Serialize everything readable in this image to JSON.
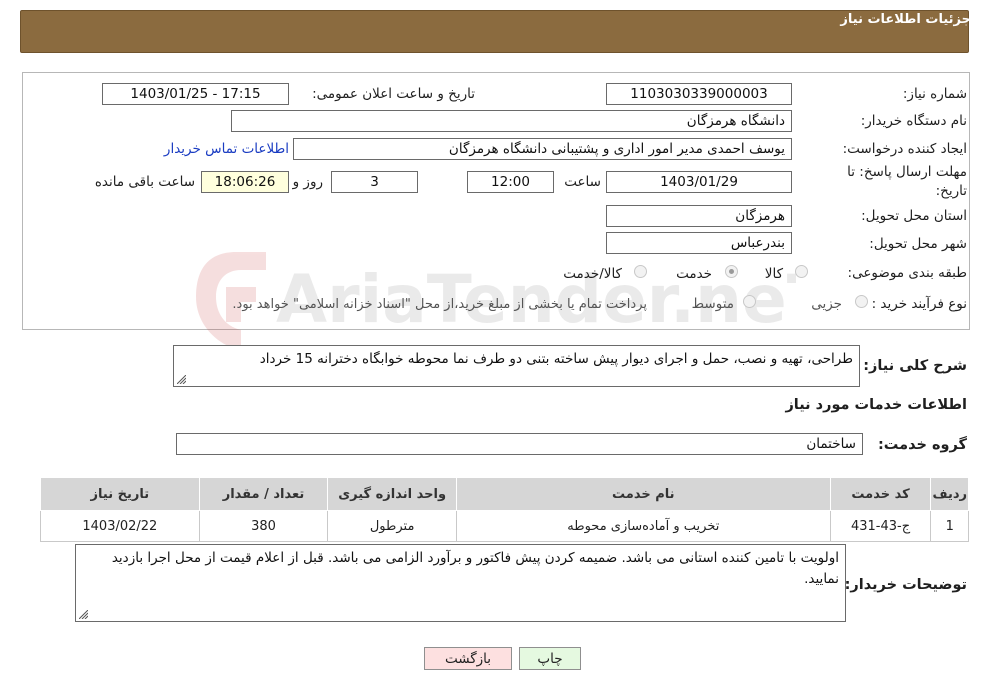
{
  "header": {
    "title": "جزئیات اطلاعات نیاز"
  },
  "form": {
    "need_number_label": "شماره نیاز:",
    "need_number_value": "1103030339000003",
    "announce_label": "تاریخ و ساعت اعلان عمومی:",
    "announce_value": "1403/01/25 - 17:15",
    "buyer_org_label": "نام دستگاه خریدار:",
    "buyer_org_value": "دانشگاه هرمزگان",
    "requester_label": "ایجاد کننده درخواست:",
    "requester_value": "یوسف احمدی مدیر امور اداری و پشتیبانی دانشگاه هرمزگان",
    "contact_link": "اطلاعات تماس خریدار",
    "deadline_label_line1": "مهلت ارسال پاسخ: تا",
    "deadline_label_line2": "تاریخ:",
    "deadline_date": "1403/01/29",
    "time_label": "ساعت",
    "deadline_time": "12:00",
    "days_value": "3",
    "days_label": "روز و",
    "remaining_value": "18:06:26",
    "remaining_label": "ساعت باقی مانده",
    "province_label": "استان محل تحویل:",
    "province_value": "هرمزگان",
    "city_label": "شهر محل تحویل:",
    "city_value": "بندرعباس",
    "category_label": "طبقه بندی موضوعی:",
    "category_options": [
      "کالا",
      "خدمت",
      "کالا/خدمت"
    ],
    "category_selected": "خدمت",
    "process_label": "نوع فرآیند خرید :",
    "process_options": [
      "جزیی",
      "متوسط"
    ],
    "payment_note": "پرداخت تمام یا بخشی از مبلغ خرید،از محل \"اسناد خزانه اسلامی\" خواهد بود."
  },
  "description": {
    "label": "شرح کلی نیاز:",
    "value": "طراحی، تهیه و نصب، حمل و اجرای دیوار پیش ساخته بتنی دو طرف نما محوطه خوابگاه دخترانه 15 خرداد"
  },
  "services": {
    "section_title": "اطلاعات خدمات مورد نیاز",
    "group_label": "گروه خدمت:",
    "group_value": "ساختمان",
    "columns": [
      "ردیف",
      "کد خدمت",
      "نام خدمت",
      "واحد اندازه گیری",
      "تعداد / مقدار",
      "تاریخ نیاز"
    ],
    "rows": [
      [
        "1",
        "ج-43-431",
        "تخریب و آماده‌سازی محوطه",
        "مترطول",
        "380",
        "1403/02/22"
      ]
    ]
  },
  "buyer_notes": {
    "label": "توضیحات خریدار:",
    "value": "اولویت با تامین کننده استانی می باشد. ضمیمه کردن پیش فاکتور و برآورد الزامی می باشد. قبل از اعلام قیمت از محل اجرا بازدید نمایید."
  },
  "buttons": {
    "print": "چاپ",
    "back": "بازگشت"
  },
  "watermark": {
    "text": "AriaTender.neT"
  },
  "colors": {
    "header_bg": "#8b6b3f",
    "link": "#1a3cc2",
    "table_header": "#d6d6d6"
  }
}
